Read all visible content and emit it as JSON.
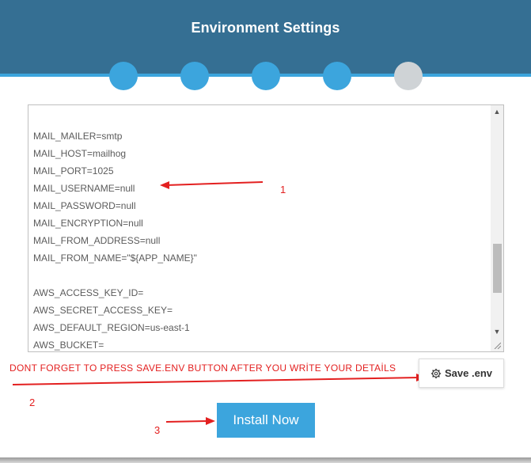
{
  "header": {
    "title": "Environment Settings"
  },
  "steps": [
    {
      "state": "done"
    },
    {
      "state": "done"
    },
    {
      "state": "done"
    },
    {
      "state": "done"
    },
    {
      "state": "current"
    }
  ],
  "env_lines": [
    "MAIL_MAILER=smtp",
    "MAIL_HOST=mailhog",
    "MAIL_PORT=1025",
    "MAIL_USERNAME=null",
    "MAIL_PASSWORD=null",
    "MAIL_ENCRYPTION=null",
    "MAIL_FROM_ADDRESS=null",
    "MAIL_FROM_NAME=\"${APP_NAME}\"",
    "",
    "AWS_ACCESS_KEY_ID=",
    "AWS_SECRET_ACCESS_KEY=",
    "AWS_DEFAULT_REGION=us-east-1",
    "AWS_BUCKET="
  ],
  "annotations": {
    "note": "DONT FORGET TO PRESS SAVE.ENV BUTTON AFTER YOU WRİTE YOUR DETAİLS",
    "n1": "1",
    "n2": "2",
    "n3": "3",
    "color": "#e32020"
  },
  "buttons": {
    "save_label": "Save .env",
    "install_label": "Install Now"
  },
  "icons": {
    "save": "gear-icon",
    "scroll_up": "arrow-up-icon",
    "scroll_down": "arrow-down-icon"
  },
  "colors": {
    "header": "#356f93",
    "accent": "#3ca5dd",
    "step_inactive": "#cfd3d6"
  }
}
